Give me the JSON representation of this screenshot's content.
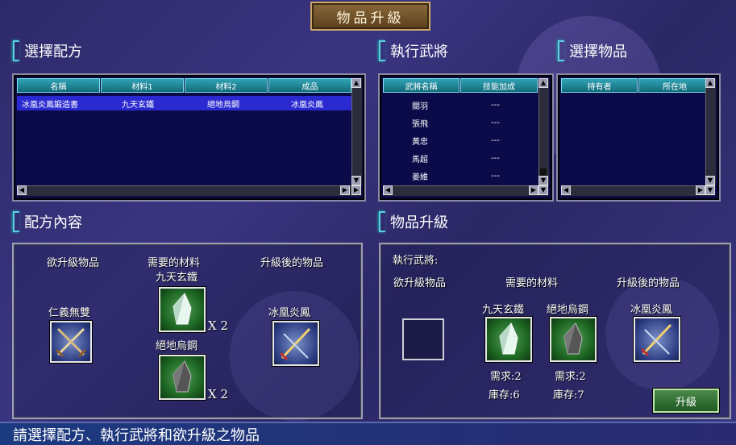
{
  "window_title": "物品升級",
  "sections": {
    "choose_recipe": "選擇配方",
    "general": "執行武將",
    "choose_item": "選擇物品",
    "recipe_content": "配方內容",
    "upgrade": "物品升級"
  },
  "recipe_list": {
    "headers": [
      "名稱",
      "材料1",
      "材料2",
      "成品"
    ],
    "rows": [
      [
        "冰凰炎鳳鍛造書",
        "九天玄鐵",
        "絕地烏鋼",
        "冰凰炎鳳"
      ]
    ]
  },
  "general_list": {
    "headers": [
      "武將名稱",
      "技能加成"
    ],
    "rows": [
      [
        "關羽",
        "---"
      ],
      [
        "張飛",
        "---"
      ],
      [
        "黃忠",
        "---"
      ],
      [
        "馬超",
        "---"
      ],
      [
        "姜維",
        "---"
      ]
    ]
  },
  "item_list": {
    "headers": [
      "持有者",
      "所在地"
    ]
  },
  "recipe_content": {
    "col_upgrade": "欲升級物品",
    "col_material": "需要的材料",
    "col_result": "升級後的物品",
    "upgrade_item": "仁義無雙",
    "material1_name": "九天玄鐵",
    "material1_qty": "X 2",
    "material2_name": "絕地烏鋼",
    "material2_qty": "X 2",
    "result_item": "冰凰炎鳳"
  },
  "upgrade_panel": {
    "general_label": "執行武將:",
    "col_upgrade": "欲升級物品",
    "col_material": "需要的材料",
    "col_result": "升級後的物品",
    "material1_name": "九天玄鐵",
    "material2_name": "絕地烏鋼",
    "result_item": "冰凰炎鳳",
    "material1_need": "需求:2",
    "material1_stock": "庫存:6",
    "material2_need": "需求:2",
    "material2_stock": "庫存:7",
    "upgrade_button": "升級"
  },
  "status_text": "請選擇配方、執行武將和欲升級之物品"
}
